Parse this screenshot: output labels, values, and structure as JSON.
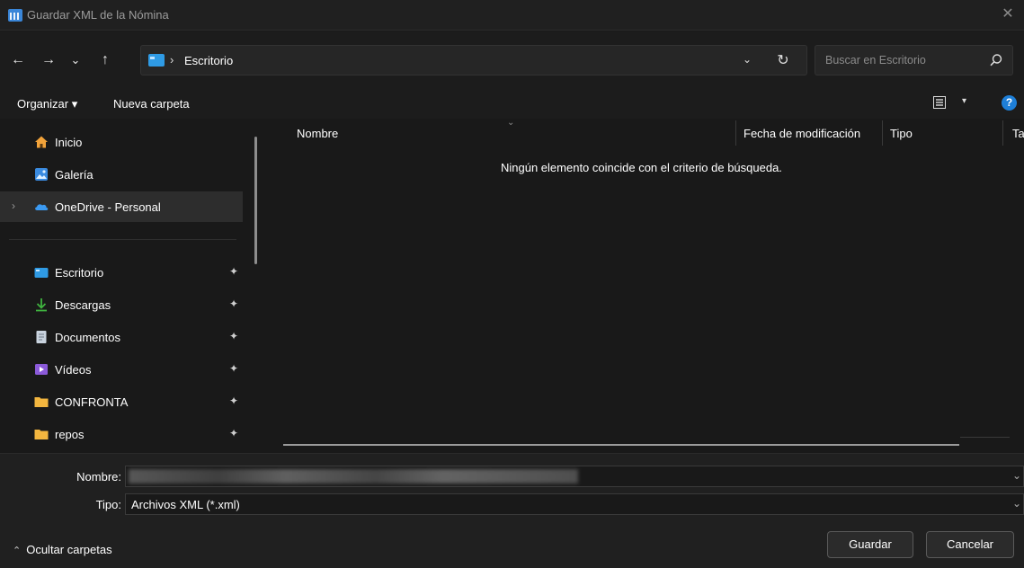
{
  "window": {
    "title": "Guardar XML de la Nómina",
    "close_glyph": "✕"
  },
  "nav": {
    "back": "←",
    "forward": "→",
    "recent": "⌄",
    "up": "↑",
    "breadcrumb_sep": "›",
    "location": "Escritorio",
    "search_placeholder": "Buscar en Escritorio"
  },
  "commands": {
    "organize": "Organizar ▾",
    "new_folder": "Nueva carpeta",
    "help": "?"
  },
  "sidebar": {
    "top": [
      {
        "label": "Inicio",
        "icon": "home-icon"
      },
      {
        "label": "Galería",
        "icon": "gallery-icon"
      },
      {
        "label": "OneDrive - Personal",
        "icon": "onedrive-icon"
      }
    ],
    "pinned": [
      {
        "label": "Escritorio",
        "icon": "desktop-folder-icon"
      },
      {
        "label": "Descargas",
        "icon": "download-icon"
      },
      {
        "label": "Documentos",
        "icon": "documents-icon"
      },
      {
        "label": "Vídeos",
        "icon": "videos-icon"
      },
      {
        "label": "CONFRONTA",
        "icon": "folder-icon"
      },
      {
        "label": "repos",
        "icon": "folder-icon"
      }
    ],
    "pin_glyph": "✦",
    "expand_glyph": "›"
  },
  "columns": {
    "name": "Nombre",
    "modified": "Fecha de modificación",
    "type": "Tipo",
    "size": "Ta"
  },
  "empty_message": "Ningún elemento coincide con el criterio de búsqueda.",
  "form": {
    "name_label": "Nombre:",
    "type_label": "Tipo:",
    "type_value": "Archivos XML (*.xml)",
    "save": "Guardar",
    "cancel": "Cancelar",
    "hide_folders": "Ocultar carpetas"
  },
  "colors": {
    "accent": "#1e7fd8",
    "folder": "#f3b63f",
    "bg": "#191919"
  }
}
